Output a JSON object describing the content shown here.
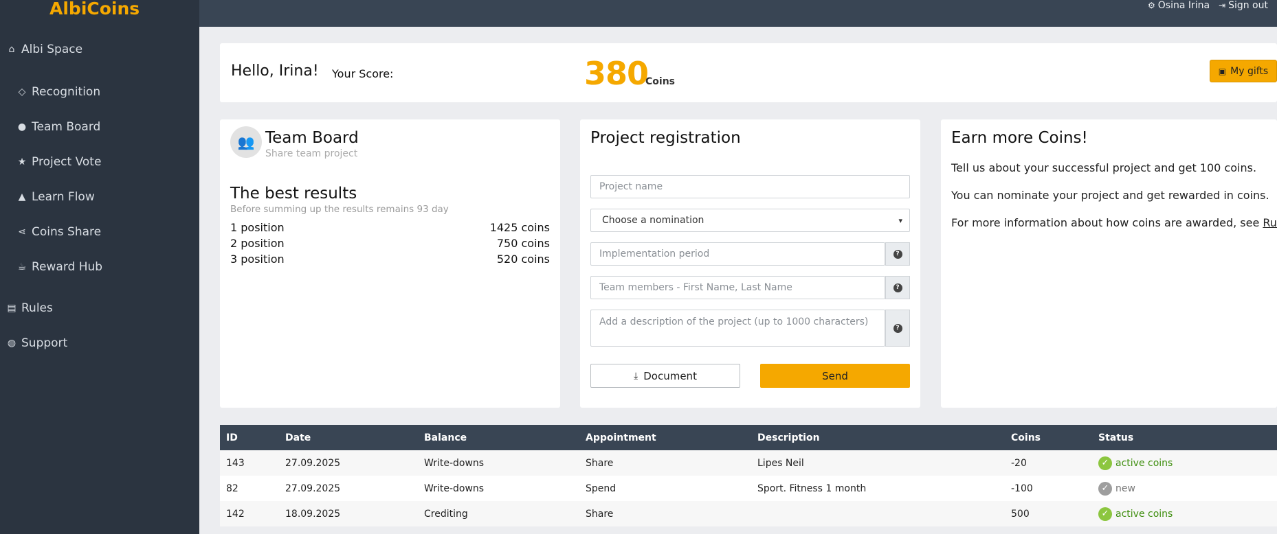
{
  "app": {
    "logo": "AlbiCoins"
  },
  "sidebar": {
    "items": [
      {
        "label": "Albi Space",
        "icon": "home-icon"
      },
      {
        "label": "Recognition",
        "icon": "diamond-icon"
      },
      {
        "label": "Team Board",
        "icon": "users-icon"
      },
      {
        "label": "Project Vote",
        "icon": "star-icon"
      },
      {
        "label": "Learn Flow",
        "icon": "graduation-cap-icon"
      },
      {
        "label": "Coins Share",
        "icon": "share-icon"
      },
      {
        "label": "Reward Hub",
        "icon": "coffee-icon"
      },
      {
        "label": "Rules",
        "icon": "newspaper-icon"
      },
      {
        "label": "Support",
        "icon": "comment-icon"
      }
    ]
  },
  "topbar": {
    "user_name": "Osina Irina",
    "signout": "Sign out"
  },
  "score": {
    "greeting": "Hello, Irina!",
    "label": "Your Score:",
    "value": "380",
    "unit": "Coins",
    "gifts_button": "My gifts"
  },
  "team_board": {
    "title": "Team Board",
    "subtitle": "Share team project",
    "results_title": "The best results",
    "results_subtitle": "Before summing up the results remains 93 day",
    "positions": [
      {
        "label": "1 position",
        "value": "1425 coins"
      },
      {
        "label": "2 position",
        "value": "750 coins"
      },
      {
        "label": "3 position",
        "value": "520 coins"
      }
    ]
  },
  "registration": {
    "title": "Project registration",
    "project_name_placeholder": "Project name",
    "nomination_selected": "Choose a nomination",
    "period_placeholder": "Implementation period",
    "team_placeholder": "Team members - First Name, Last Name",
    "description_placeholder": "Add a description of the project (up to 1000 characters)",
    "document_button": "Document",
    "send_button": "Send"
  },
  "earn": {
    "title": "Earn more Coins!",
    "line1": "Tell us about your successful project and get 100 coins.",
    "line2": "You can nominate your project and get rewarded in coins.",
    "line3_prefix": "For more information about how coins are awarded, see ",
    "line3_link": "Rules",
    "line3_suffix": "."
  },
  "table": {
    "headers": [
      "ID",
      "Date",
      "Balance",
      "Appointment",
      "Description",
      "Coins",
      "Status"
    ],
    "rows": [
      {
        "id": "143",
        "date": "27.09.2025",
        "balance": "Write-downs",
        "appointment": "Share",
        "description": "Lipes Neil",
        "coins": "-20",
        "status": "active coins"
      },
      {
        "id": "82",
        "date": "27.09.2025",
        "balance": "Write-downs",
        "appointment": "Spend",
        "description": "Sport. Fitness 1 month",
        "coins": "-100",
        "status": "new"
      },
      {
        "id": "142",
        "date": "18.09.2025",
        "balance": "Crediting",
        "appointment": "Share",
        "description": "",
        "coins": "500",
        "status": "active coins"
      }
    ]
  },
  "colors": {
    "accent": "#f5a800",
    "sidebar": "#2b3440",
    "topbar": "#394554",
    "active_status": "#8cc63f",
    "new_status": "#9e9e9e"
  }
}
